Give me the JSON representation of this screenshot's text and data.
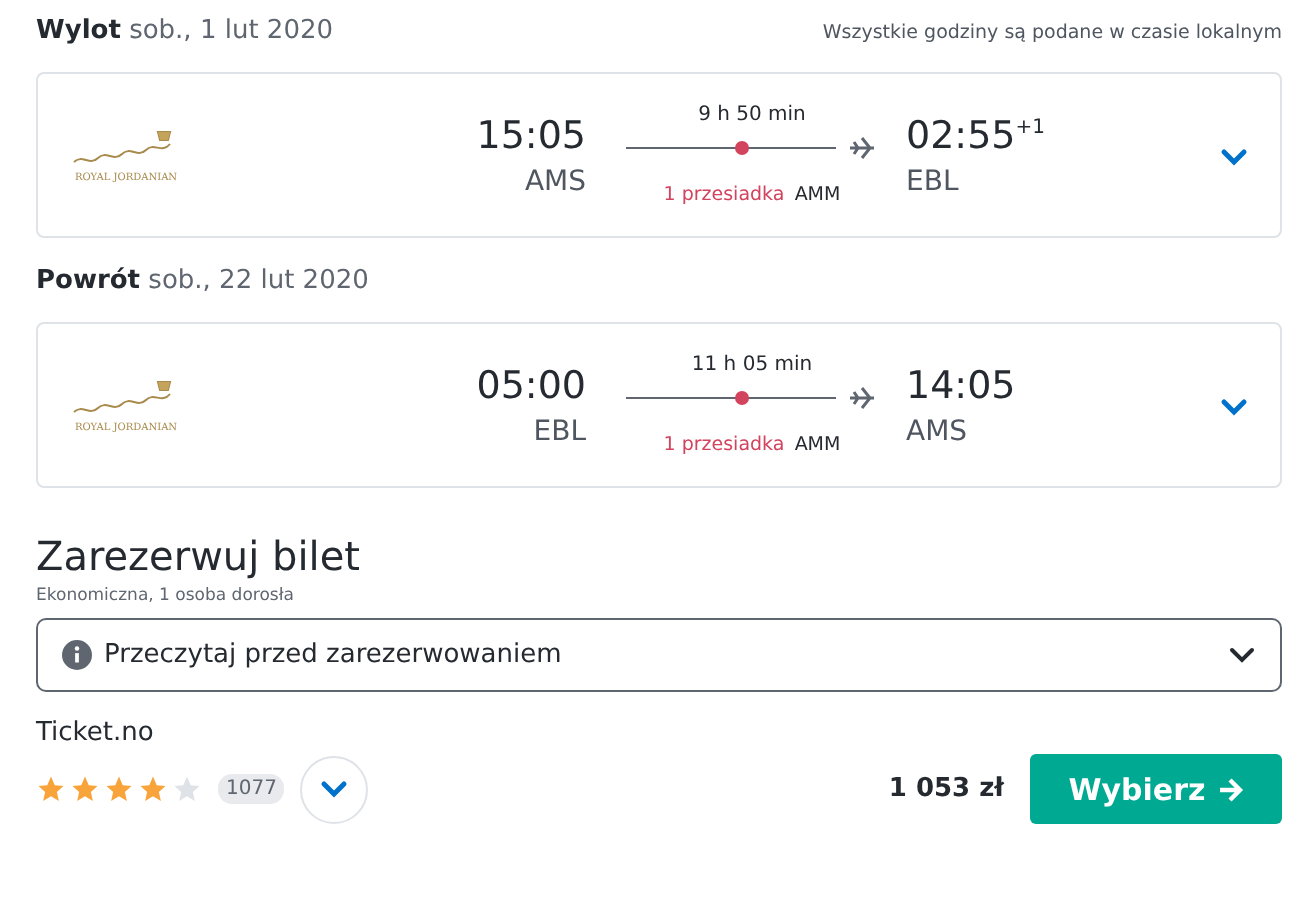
{
  "legs": [
    {
      "label": "Wylot",
      "date": "sob., 1 lut 2020",
      "note": "Wszystkie godziny są podane w czasie lokalnym",
      "airline": "ROYAL JORDANIAN",
      "depart_time": "15:05",
      "depart_code": "AMS",
      "duration": "9 h 50 min",
      "stops": "1 przesiadka",
      "stop_code": "AMM",
      "arrive_time": "02:55",
      "arrive_offset": "+1",
      "arrive_code": "EBL"
    },
    {
      "label": "Powrót",
      "date": "sob., 22 lut 2020",
      "airline": "ROYAL JORDANIAN",
      "depart_time": "05:00",
      "depart_code": "EBL",
      "duration": "11 h 05 min",
      "stops": "1 przesiadka",
      "stop_code": "AMM",
      "arrive_time": "14:05",
      "arrive_code": "AMS"
    }
  ],
  "booking": {
    "title": "Zarezerwuj bilet",
    "subtitle": "Ekonomiczna, 1 osoba dorosła",
    "info": "Przeczytaj przed zarezerwowaniem",
    "provider": "Ticket.no",
    "stars": 4,
    "reviews": "1077",
    "price": "1 053 zł",
    "button": "Wybierz"
  }
}
